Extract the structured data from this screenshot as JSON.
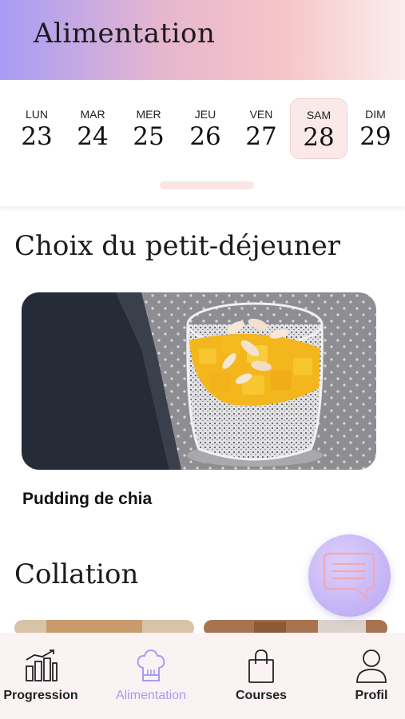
{
  "header": {
    "title": "Alimentation"
  },
  "week": {
    "days": [
      {
        "name": "LUN",
        "num": "23"
      },
      {
        "name": "MAR",
        "num": "24"
      },
      {
        "name": "MER",
        "num": "25"
      },
      {
        "name": "JEU",
        "num": "26"
      },
      {
        "name": "VEN",
        "num": "27"
      },
      {
        "name": "SAM",
        "num": "28"
      },
      {
        "name": "DIM",
        "num": "29"
      }
    ],
    "selected_day": "SAM"
  },
  "breakfast": {
    "title": "Choix du petit-déjeuner",
    "meal_name": "Pudding de chia"
  },
  "snack": {
    "title": "Collation"
  },
  "chat_button": {
    "icon": "chat-icon"
  },
  "tabbar": {
    "tabs": [
      {
        "label": "Progression",
        "icon": "progression-icon"
      },
      {
        "label": "Alimentation",
        "icon": "chef-hat-icon",
        "active": true
      },
      {
        "label": "Courses",
        "icon": "shopping-bag-icon"
      },
      {
        "label": "Profil",
        "icon": "profile-icon"
      }
    ]
  },
  "colors": {
    "accent": "#a79cf3",
    "selected_day_bg": "#fbe9e9",
    "tabbar_bg": "#fbf3f3"
  }
}
